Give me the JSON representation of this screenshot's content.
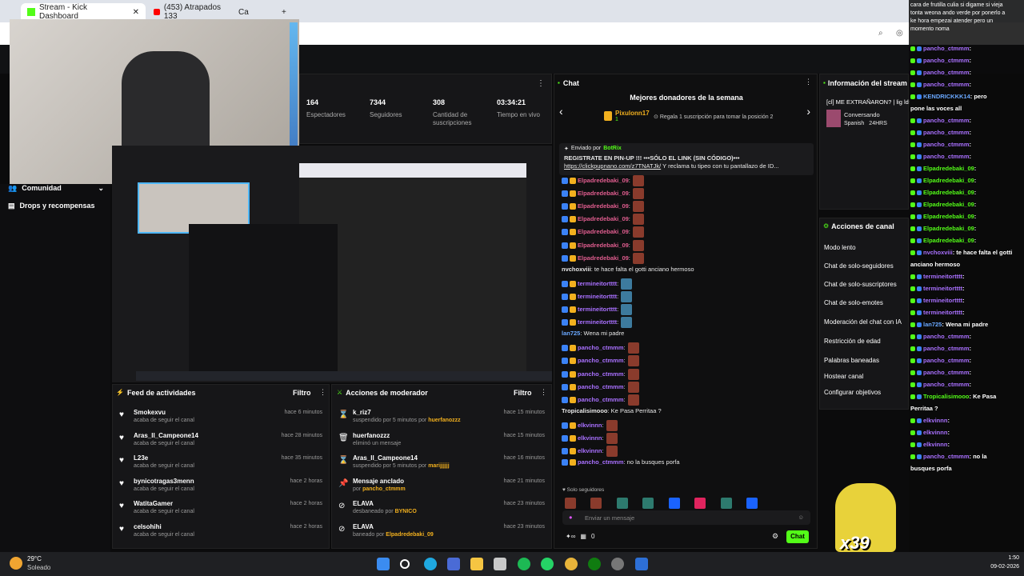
{
  "browser": {
    "tabs": [
      {
        "label": "Stream - Kick Dashboard"
      },
      {
        "label": "(453) Atrapados 133"
      },
      {
        "label": "Ca"
      }
    ]
  },
  "stats": [
    {
      "value": "164",
      "label": "Espectadores"
    },
    {
      "value": "7344",
      "label": "Seguidores"
    },
    {
      "value": "308",
      "label": "Cantidad de suscripciones"
    },
    {
      "value": "03:34:21",
      "label": "Tiempo en vivo"
    }
  ],
  "sidebar": {
    "items": [
      {
        "label": "Comunidad"
      },
      {
        "label": "Drops y recompensas"
      }
    ]
  },
  "activity_feed": {
    "title": "Feed de actividades",
    "filter": "Filtro",
    "items": [
      {
        "name": "Smokexvu",
        "sub": "acaba de seguir el canal",
        "time": "hace 6 minutos"
      },
      {
        "name": "Aras_Il_Campeone14",
        "sub": "acaba de seguir el canal",
        "time": "hace 28 minutos"
      },
      {
        "name": "L23e",
        "sub": "acaba de seguir el canal",
        "time": "hace 35 minutos"
      },
      {
        "name": "bynicotragas3menn",
        "sub": "acaba de seguir el canal",
        "time": "hace 2 horas"
      },
      {
        "name": "WatitaGamer",
        "sub": "acaba de seguir el canal",
        "time": "hace 2 horas"
      },
      {
        "name": "celsohihi",
        "sub": "acaba de seguir el canal",
        "time": "hace 2 horas"
      }
    ]
  },
  "mod_actions": {
    "title": "Acciones de moderador",
    "filter": "Filtro",
    "items": [
      {
        "name": "k_riz7",
        "sub": "suspendido por 5 minutos por",
        "by": "huerfanozzz",
        "time": "hace 15 minutos"
      },
      {
        "name": "huerfanozzz",
        "sub": "eliminó un mensaje",
        "by": "",
        "time": "hace 15 minutos"
      },
      {
        "name": "Aras_Il_Campeone14",
        "sub": "suspendido por 5 minutos por",
        "by": "marijjjjjj",
        "time": "hace 16 minutos"
      },
      {
        "name": "Mensaje anclado",
        "sub": "por",
        "by": "pancho_ctmmm",
        "time": "hace 21 minutos"
      },
      {
        "name": "ELAVA",
        "sub": "desbaneado por",
        "by": "BYNICO",
        "time": "hace 23 minutos"
      },
      {
        "name": "ELAVA",
        "sub": "baneado por",
        "by": "Elpadredebaki_09",
        "time": "hace 23 minutos"
      }
    ]
  },
  "chat": {
    "title": "Chat",
    "donors_title": "Mejores donadores de la semana",
    "top_donor": "Pixulonn17",
    "top_donor_count": "1",
    "donor_hint": "Regala 1 suscripción para tomar la posición 2",
    "pinned_by_label": "Enviado por",
    "pinned_by": "BotRix",
    "pinned_text": "REGISTRATE EN PIN-UP",
    "pinned_text2": "!!! •••SÓLO EL LINK (SIN CÓDIGO)•••",
    "pinned_link": "https://clickpupnano.com/z7TNATJk/",
    "pinned_tail": "Y reclama tu tipeo con tu pantallazo de ID...",
    "messages": [
      {
        "user": "Elpadredebaki_09",
        "text": ":"
      },
      {
        "user": "Elpadredebaki_09",
        "text": ":"
      },
      {
        "user": "Elpadredebaki_09",
        "text": ":"
      },
      {
        "user": "Elpadredebaki_09",
        "text": ":"
      },
      {
        "user": "Elpadredebaki_09",
        "text": ":"
      },
      {
        "user": "Elpadredebaki_09",
        "text": ":"
      },
      {
        "user": "Elpadredebaki_09",
        "text": ":"
      },
      {
        "user": "nvchoxviii",
        "text": ": te hace falta el gotti anciano hermoso"
      },
      {
        "user": "termineitortttt",
        "text": ":"
      },
      {
        "user": "termineitortttt",
        "text": ":"
      },
      {
        "user": "termineitortttt",
        "text": ":"
      },
      {
        "user": "termineitortttt",
        "text": ":"
      },
      {
        "user": "lan725",
        "text": ": Wena mi padre"
      },
      {
        "user": "pancho_ctmmm",
        "text": ":"
      },
      {
        "user": "pancho_ctmmm",
        "text": ":"
      },
      {
        "user": "pancho_ctmmm",
        "text": ":"
      },
      {
        "user": "pancho_ctmmm",
        "text": ":"
      },
      {
        "user": "pancho_ctmmm",
        "text": ":"
      },
      {
        "user": "Tropicalisimooo",
        "text": ": Ke Pasa Perritaa ?"
      },
      {
        "user": "elkvinnn",
        "text": ":"
      },
      {
        "user": "elkvinnn",
        "text": ":"
      },
      {
        "user": "elkvinnn",
        "text": ":"
      },
      {
        "user": "pancho_ctmmm",
        "text": ": no la busques porfa"
      }
    ],
    "followers_only": "Solo seguidores",
    "input_placeholder": "Enviar un mensaje",
    "points": "0",
    "send_label": "Chat"
  },
  "stream_info": {
    "title": "Información del stream",
    "stream_title": "[cl] ME EXTRAÑARON? | lig lds lvoces",
    "category": "Conversando",
    "tags": [
      "Spanish",
      "24HRS",
      "Chile",
      "Espa"
    ]
  },
  "channel_actions": {
    "title": "Acciones de canal",
    "items": [
      "Modo lento",
      "Chat de solo-seguidores",
      "Chat de solo-suscriptores",
      "Chat de solo-emotes",
      "Moderación del chat con IA",
      "Restricción de edad",
      "Palabras baneadas",
      "Hostear canal",
      "Configurar objetivos"
    ]
  },
  "overlay_chat": {
    "header_lines": [
      "cara de frutilla culia si digame si vieja",
      "tonta weona ando verde por ponerlo a",
      "ke hora empezai atender pero un",
      "momento noma"
    ],
    "lines": [
      {
        "user": "pancho_ctmmm",
        "text": ":",
        "color": "#a970ff"
      },
      {
        "user": "pancho_ctmmm",
        "text": ":",
        "color": "#a970ff"
      },
      {
        "user": "pancho_ctmmm",
        "text": ":",
        "color": "#a970ff"
      },
      {
        "user": "pancho_ctmmm",
        "text": ":",
        "color": "#a970ff"
      },
      {
        "user": "KENDRICKKK14",
        "text": ": pero",
        "color": "#6aa8ff"
      },
      {
        "user": "pone las voces all",
        "text": "",
        "color": "#ffffff"
      },
      {
        "user": "pancho_ctmmm",
        "text": ":",
        "color": "#a970ff"
      },
      {
        "user": "pancho_ctmmm",
        "text": ":",
        "color": "#a970ff"
      },
      {
        "user": "pancho_ctmmm",
        "text": ":",
        "color": "#a970ff"
      },
      {
        "user": "pancho_ctmmm",
        "text": ":",
        "color": "#a970ff"
      },
      {
        "user": "Elpadredebaki_09",
        "text": ":",
        "color": "#53fc18"
      },
      {
        "user": "Elpadredebaki_09",
        "text": ":",
        "color": "#53fc18"
      },
      {
        "user": "Elpadredebaki_09",
        "text": ":",
        "color": "#53fc18"
      },
      {
        "user": "Elpadredebaki_09",
        "text": ":",
        "color": "#53fc18"
      },
      {
        "user": "Elpadredebaki_09",
        "text": ":",
        "color": "#53fc18"
      },
      {
        "user": "Elpadredebaki_09",
        "text": ":",
        "color": "#53fc18"
      },
      {
        "user": "Elpadredebaki_09",
        "text": ":",
        "color": "#53fc18"
      },
      {
        "user": "nvchoxviii",
        "text": ": te hace falta el gotti",
        "color": "#a970ff"
      },
      {
        "user": "anciano hermoso",
        "text": "",
        "color": "#ffffff"
      },
      {
        "user": "termineitortttt",
        "text": ":",
        "color": "#a970ff"
      },
      {
        "user": "termineitortttt",
        "text": ":",
        "color": "#a970ff"
      },
      {
        "user": "termineitortttt",
        "text": ":",
        "color": "#a970ff"
      },
      {
        "user": "termineitortttt",
        "text": ":",
        "color": "#a970ff"
      },
      {
        "user": "lan725",
        "text": ": Wena mi padre",
        "color": "#6aa8ff"
      },
      {
        "user": "pancho_ctmmm",
        "text": ":",
        "color": "#a970ff"
      },
      {
        "user": "pancho_ctmmm",
        "text": ":",
        "color": "#a970ff"
      },
      {
        "user": "pancho_ctmmm",
        "text": ":",
        "color": "#a970ff"
      },
      {
        "user": "pancho_ctmmm",
        "text": ":",
        "color": "#a970ff"
      },
      {
        "user": "pancho_ctmmm",
        "text": ":",
        "color": "#a970ff"
      },
      {
        "user": "Tropicalisimooo",
        "text": ": Ke Pasa",
        "color": "#53fc18"
      },
      {
        "user": "Perritaa ?",
        "text": "",
        "color": "#ffffff"
      },
      {
        "user": "elkvinnn",
        "text": ":",
        "color": "#a970ff"
      },
      {
        "user": "elkvinnn",
        "text": ":",
        "color": "#a970ff"
      },
      {
        "user": "elkvinnn",
        "text": ":",
        "color": "#a970ff"
      },
      {
        "user": "pancho_ctmmm",
        "text": ": no la",
        "color": "#a970ff"
      },
      {
        "user": "busques porfa",
        "text": "",
        "color": "#ffffff"
      }
    ]
  },
  "overlay_badge": "x39",
  "taskbar": {
    "weather_temp": "29°C",
    "weather_desc": "Soleado",
    "time": "1:50",
    "date": "09-02-2026"
  },
  "colors": {
    "kick_green": "#53fc18",
    "panel_bg": "#161618",
    "accent_purple": "#a970ff"
  }
}
